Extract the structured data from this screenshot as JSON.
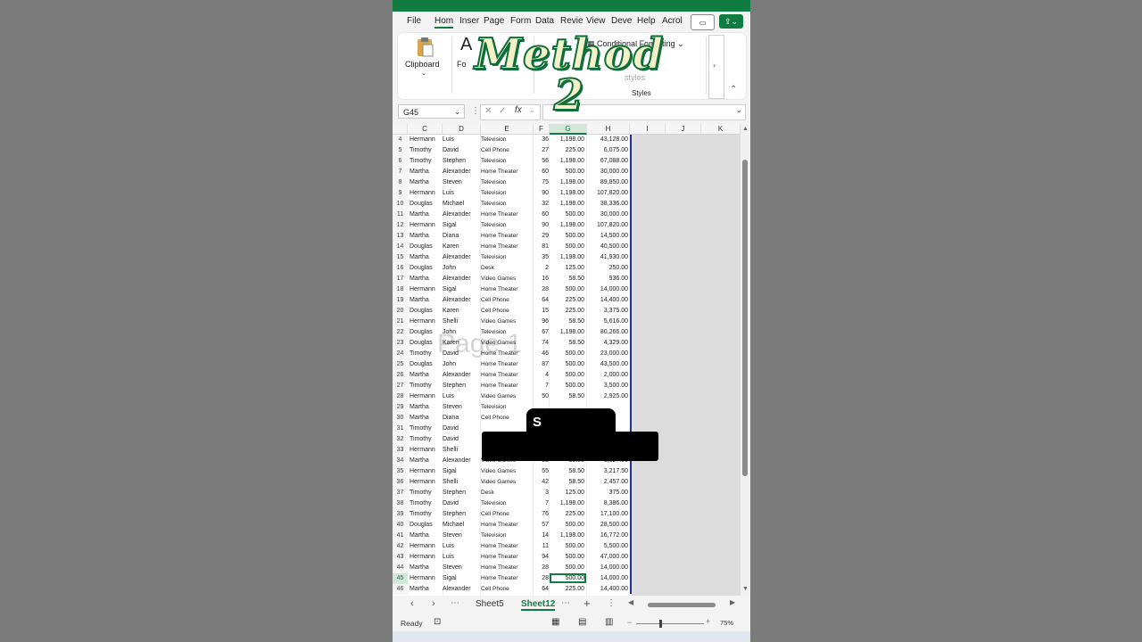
{
  "menu": {
    "items": [
      "File",
      "Hom",
      "Inser",
      "Page",
      "Form",
      "Data",
      "Revie",
      "View",
      "Deve",
      "Help",
      "Acrol"
    ],
    "active_index": 1
  },
  "ribbon": {
    "clipboard_label": "Clipboard",
    "font_label": "Fo",
    "cond_format_label": "Conditional Fo",
    "cond_format_suffix": "matting",
    "styles_label": "Styles",
    "cell_styles_fragment": "styles"
  },
  "formula": {
    "namebox": "G45",
    "fx": "fx"
  },
  "overlay": {
    "line1": "Method",
    "line2": "2"
  },
  "watermark": "Page 1",
  "redaction": {
    "visible_letter": "S"
  },
  "columns": [
    "C",
    "D",
    "E",
    "F",
    "G",
    "H",
    "I",
    "J",
    "K"
  ],
  "selected_column": "G",
  "selected_row": "45",
  "rows": [
    [
      "4",
      "Hermann",
      "Luis",
      "Television",
      "36",
      "1,198.00",
      "43,128.00"
    ],
    [
      "5",
      "Timothy",
      "David",
      "Cell Phone",
      "27",
      "225.00",
      "6,075.00"
    ],
    [
      "6",
      "Timothy",
      "Stephen",
      "Television",
      "56",
      "1,198.00",
      "67,088.00"
    ],
    [
      "7",
      "Martha",
      "Alexander",
      "Home Theater",
      "60",
      "500.00",
      "30,000.00"
    ],
    [
      "8",
      "Martha",
      "Steven",
      "Television",
      "75",
      "1,198.00",
      "89,850.00"
    ],
    [
      "9",
      "Hermann",
      "Luis",
      "Television",
      "90",
      "1,198.00",
      "107,820.00"
    ],
    [
      "10",
      "Douglas",
      "Michael",
      "Television",
      "32",
      "1,198.00",
      "38,336.00"
    ],
    [
      "11",
      "Martha",
      "Alexander",
      "Home Theater",
      "60",
      "500.00",
      "30,000.00"
    ],
    [
      "12",
      "Hermann",
      "Sigal",
      "Television",
      "90",
      "1,198.00",
      "107,820.00"
    ],
    [
      "13",
      "Martha",
      "Diana",
      "Home Theater",
      "29",
      "500.00",
      "14,500.00"
    ],
    [
      "14",
      "Douglas",
      "Karen",
      "Home Theater",
      "81",
      "500.00",
      "40,500.00"
    ],
    [
      "15",
      "Martha",
      "Alexander",
      "Television",
      "35",
      "1,198.00",
      "41,930.00"
    ],
    [
      "16",
      "Douglas",
      "John",
      "Desk",
      "2",
      "125.00",
      "250.00"
    ],
    [
      "17",
      "Martha",
      "Alexander",
      "Video Games",
      "16",
      "58.50",
      "936.00"
    ],
    [
      "18",
      "Hermann",
      "Sigal",
      "Home Theater",
      "28",
      "500.00",
      "14,000.00"
    ],
    [
      "19",
      "Martha",
      "Alexander",
      "Cell Phone",
      "64",
      "225.00",
      "14,400.00"
    ],
    [
      "20",
      "Douglas",
      "Karen",
      "Cell Phone",
      "15",
      "225.00",
      "3,375.00"
    ],
    [
      "21",
      "Hermann",
      "Shelli",
      "Video Games",
      "96",
      "58.50",
      "5,616.00"
    ],
    [
      "22",
      "Douglas",
      "John",
      "Television",
      "67",
      "1,198.00",
      "80,266.00"
    ],
    [
      "23",
      "Douglas",
      "Karen",
      "Video Games",
      "74",
      "58.50",
      "4,329.00"
    ],
    [
      "24",
      "Timothy",
      "David",
      "Home Theater",
      "46",
      "500.00",
      "23,000.00"
    ],
    [
      "25",
      "Douglas",
      "John",
      "Home Theater",
      "87",
      "500.00",
      "43,500.00"
    ],
    [
      "26",
      "Martha",
      "Alexander",
      "Home Theater",
      "4",
      "500.00",
      "2,000.00"
    ],
    [
      "27",
      "Timothy",
      "Stephen",
      "Home Theater",
      "7",
      "500.00",
      "3,500.00"
    ],
    [
      "28",
      "Hermann",
      "Luis",
      "Video Games",
      "50",
      "58.50",
      "2,925.00"
    ],
    [
      "29",
      "Martha",
      "Steven",
      "Television",
      "",
      "",
      ""
    ],
    [
      "30",
      "Martha",
      "Diana",
      "Cell Phone",
      "",
      "",
      ""
    ],
    [
      "31",
      "Timothy",
      "David",
      "",
      "",
      "",
      ""
    ],
    [
      "32",
      "Timothy",
      "David",
      "",
      "",
      "",
      ""
    ],
    [
      "33",
      "Hermann",
      "Shelli",
      "",
      "",
      "",
      ""
    ],
    [
      "34",
      "Martha",
      "Alexander",
      "Video Games",
      "62",
      "58.50",
      "3,627.00"
    ],
    [
      "35",
      "Hermann",
      "Sigal",
      "Video Games",
      "55",
      "58.50",
      "3,217.50"
    ],
    [
      "36",
      "Hermann",
      "Shelli",
      "Video Games",
      "42",
      "58.50",
      "2,457.00"
    ],
    [
      "37",
      "Timothy",
      "Stephen",
      "Desk",
      "3",
      "125.00",
      "375.00"
    ],
    [
      "38",
      "Timothy",
      "David",
      "Television",
      "7",
      "1,198.00",
      "8,386.00"
    ],
    [
      "39",
      "Timothy",
      "Stephen",
      "Cell Phone",
      "76",
      "225.00",
      "17,100.00"
    ],
    [
      "40",
      "Douglas",
      "Michael",
      "Home Theater",
      "57",
      "500.00",
      "28,500.00"
    ],
    [
      "41",
      "Martha",
      "Steven",
      "Television",
      "14",
      "1,198.00",
      "16,772.00"
    ],
    [
      "42",
      "Hermann",
      "Luis",
      "Home Theater",
      "11",
      "500.00",
      "5,500.00"
    ],
    [
      "43",
      "Hermann",
      "Luis",
      "Home Theater",
      "94",
      "500.00",
      "47,000.00"
    ],
    [
      "44",
      "Martha",
      "Steven",
      "Home Theater",
      "28",
      "500.00",
      "14,000.00"
    ],
    [
      "45",
      "Hermann",
      "Sigal",
      "Home Theater",
      "28",
      "500.00",
      "14,000.00"
    ],
    [
      "46",
      "Martha",
      "Alexander",
      "Cell Phone",
      "64",
      "225.00",
      "14,400.00"
    ]
  ],
  "tabs": {
    "sheets": [
      "Sheet5",
      "Sheet12"
    ],
    "active": "Sheet12"
  },
  "status": {
    "ready": "Ready",
    "zoom": "75%"
  }
}
